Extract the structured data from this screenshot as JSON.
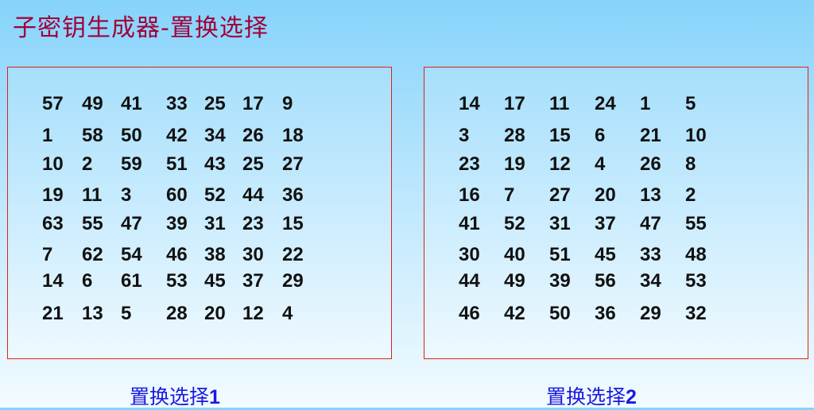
{
  "title": "子密钥生成器-置换选择",
  "tables": [
    {
      "caption": "置换选择",
      "caption_num": "1",
      "rows": [
        [
          "57",
          "49",
          "41",
          "33",
          "25",
          "17",
          "9"
        ],
        [
          "1",
          "58",
          "50",
          "42",
          "34",
          "26",
          "18"
        ],
        [
          "10",
          "2",
          "59",
          "51",
          "43",
          "25",
          "27"
        ],
        [
          "19",
          "11",
          "3",
          "60",
          "52",
          "44",
          "36"
        ],
        [
          "63",
          "55",
          "47",
          "39",
          "31",
          "23",
          "15"
        ],
        [
          "7",
          "62",
          "54",
          "46",
          "38",
          "30",
          "22"
        ],
        [
          "14",
          "6",
          "61",
          "53",
          "45",
          "37",
          "29"
        ],
        [
          "21",
          "13",
          "5",
          "28",
          "20",
          "12",
          "4"
        ]
      ]
    },
    {
      "caption": "置换选择",
      "caption_num": "2",
      "rows": [
        [
          "14",
          "17",
          "11",
          "24",
          "1",
          "5"
        ],
        [
          "3",
          "28",
          "15",
          "6",
          "21",
          "10"
        ],
        [
          "23",
          "19",
          "12",
          "4",
          "26",
          "8"
        ],
        [
          "16",
          "7",
          "27",
          "20",
          "13",
          "2"
        ],
        [
          "41",
          "52",
          "31",
          "37",
          "47",
          "55"
        ],
        [
          "30",
          "40",
          "51",
          "45",
          "33",
          "48"
        ],
        [
          "44",
          "49",
          "39",
          "56",
          "34",
          "53"
        ],
        [
          "46",
          "42",
          "50",
          "36",
          "29",
          "32"
        ]
      ]
    }
  ]
}
